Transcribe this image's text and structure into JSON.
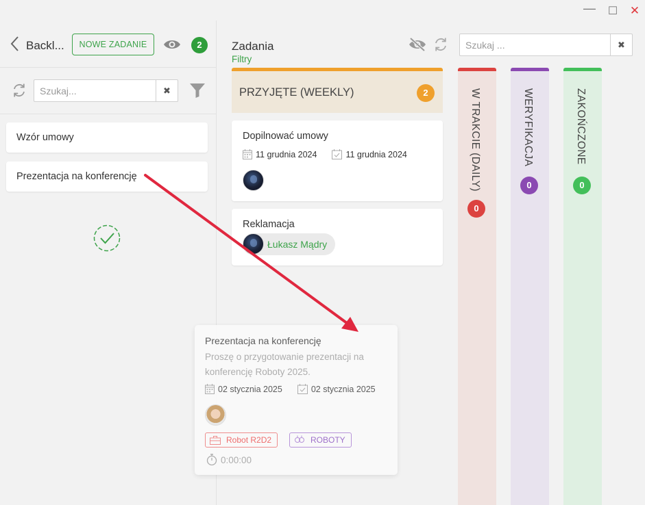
{
  "window": {
    "minimize": "—",
    "maximize": "☐",
    "close": "✕"
  },
  "backlog": {
    "title": "Backl...",
    "new_task_label": "NOWE ZADANIE",
    "count": "2",
    "search_placeholder": "Szukaj...",
    "items": [
      {
        "label": "Wzór umowy"
      },
      {
        "label": "Prezentacja na konferencję"
      }
    ]
  },
  "board": {
    "title": "Zadania",
    "subtitle": "Filtry",
    "search_placeholder": "Szukaj ...",
    "columns": [
      {
        "label": "PRZYJĘTE (WEEKLY)",
        "count": "2",
        "color": "#efa02c"
      },
      {
        "label": "W TRAKCIE (DAILY)",
        "count": "0",
        "color": "#dc4340"
      },
      {
        "label": "WERYFIKACJA",
        "count": "0",
        "color": "#8b4ab2"
      },
      {
        "label": "ZAKOŃCZONE",
        "count": "0",
        "color": "#43bf5a"
      }
    ],
    "cards": [
      {
        "title": "Dopilnować umowy",
        "start_date": "11 grudnia 2024",
        "due_date": "11 grudnia 2024"
      },
      {
        "title": "Reklamacja",
        "assignee": "Łukasz Mądry"
      }
    ]
  },
  "dragged_card": {
    "title": "Prezentacja na konferencję",
    "description": "Proszę o przygotowanie prezentacji na konferencję Roboty 2025.",
    "start_date": "02 stycznia 2025",
    "due_date": "02 stycznia 2025",
    "tags": [
      {
        "label": "Robot R2D2",
        "color": "#e66666"
      },
      {
        "label": "ROBOTY",
        "color": "#9a6ac8"
      }
    ],
    "timer": "0:00:00"
  },
  "icons": [
    "back-icon",
    "eye-icon",
    "refresh-icon",
    "filter-icon",
    "clear-icon",
    "check-circle-icon",
    "eye-off-icon",
    "calendar-icon",
    "calendar-check-icon",
    "briefcase-icon",
    "robot-icon",
    "stopwatch-icon"
  ],
  "accent": "#3da34a"
}
